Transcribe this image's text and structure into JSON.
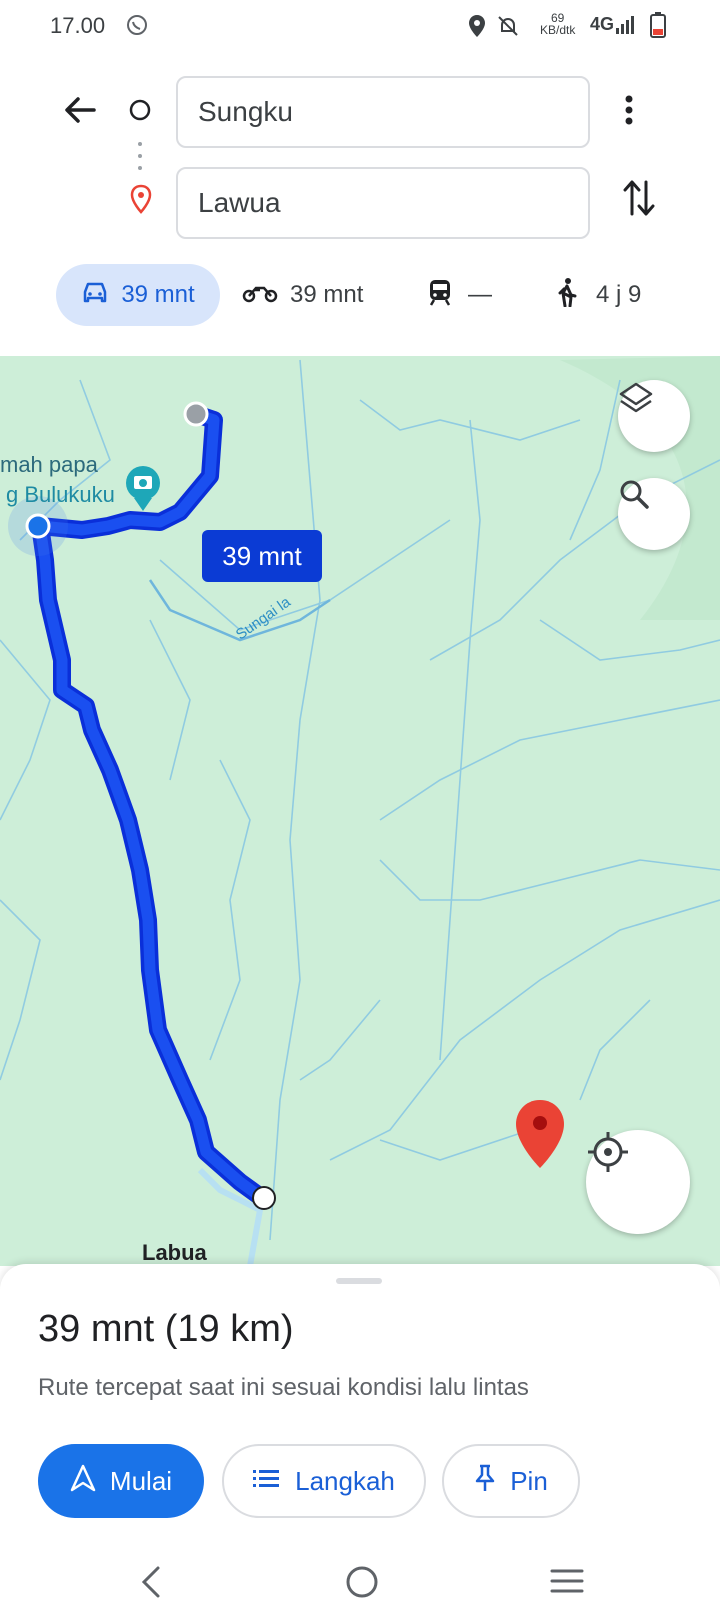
{
  "status": {
    "time": "17.00",
    "speed_value": "69",
    "speed_unit": "KB/dtk",
    "network": "4G"
  },
  "search": {
    "origin": "Sungku",
    "destination": "Lawua"
  },
  "modes": {
    "drive": "39 mnt",
    "motorcycle": "39 mnt",
    "transit": "—",
    "walk": "4 j 9"
  },
  "map": {
    "route_duration": "39 mnt",
    "place_name_line1": "mah papa",
    "place_name_line2": "g Bulukuku",
    "river_label": "Sungai la",
    "town_label": "Labua",
    "route_color": "#1533e6",
    "map_color": "#cdeed8",
    "river_color": "#6fb6dc"
  },
  "sheet": {
    "summary": "39 mnt (19 km)",
    "description": "Rute tercepat saat ini sesuai kondisi lalu lintas",
    "start_label": "Mulai",
    "steps_label": "Langkah",
    "pin_label": "Pin"
  },
  "colors": {
    "accent": "#1a73e8",
    "destination_pin": "#ea4335"
  }
}
